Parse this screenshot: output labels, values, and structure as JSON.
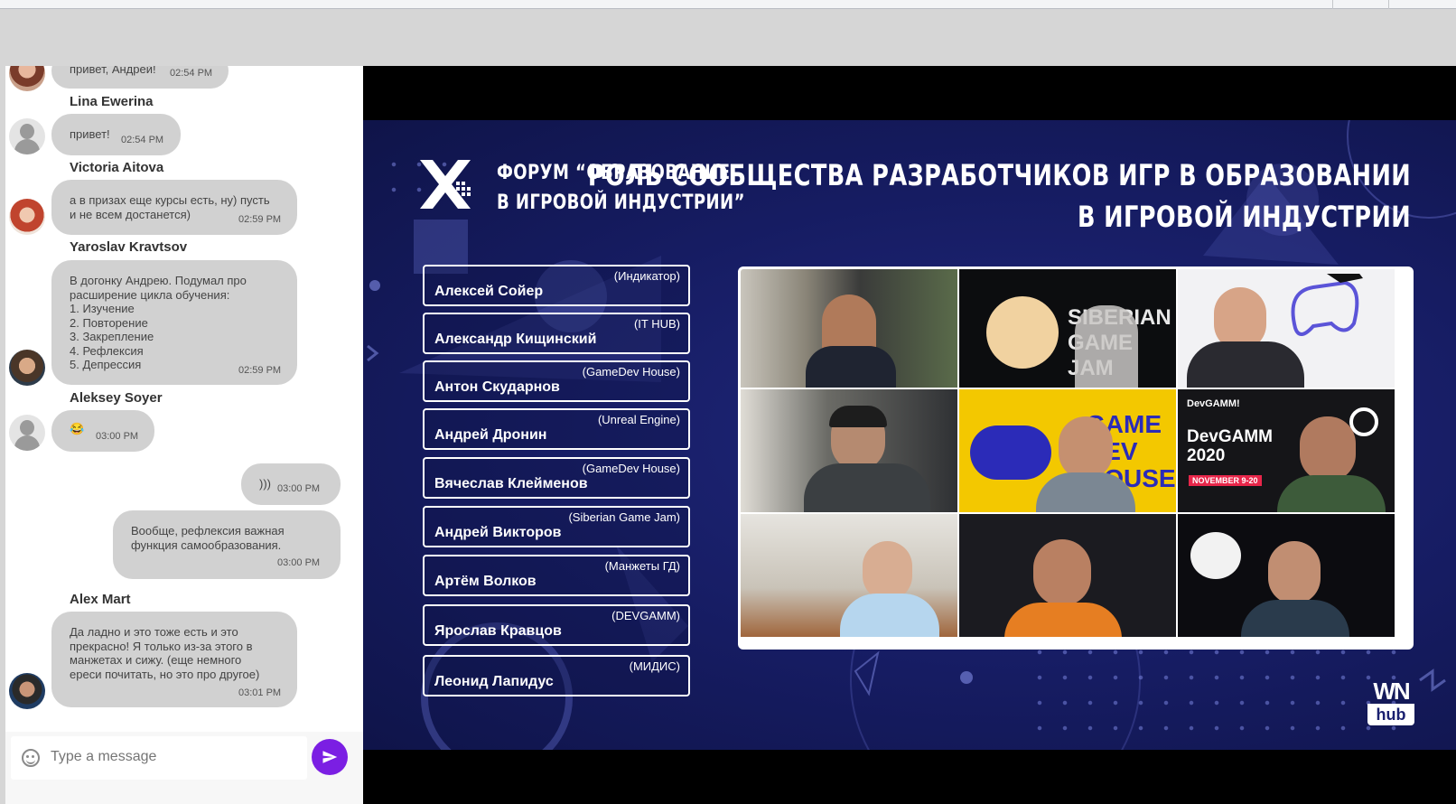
{
  "chat": {
    "messages": [
      {
        "sender": "",
        "text": "привет, Андрей!",
        "time": "02:54 PM"
      },
      {
        "sender": "Lina Ewerina",
        "text": "привет!",
        "time": "02:54 PM"
      },
      {
        "sender": "Victoria Aitova",
        "text": "а в призах еще курсы есть, ну) пусть\nи не всем достанется)",
        "time": "02:59 PM"
      },
      {
        "sender": "Yaroslav Kravtsov",
        "text": "В догонку Андрею. Подумал про\nрасширение цикла обучения:\n1. Изучение\n2. Повторение\n3. Закрепление\n4. Рефлексия\n5. Депрессия",
        "time": "02:59 PM"
      },
      {
        "sender": "Aleksey Soyer",
        "text": "😂",
        "time": "03:00 PM"
      },
      {
        "sender": "",
        "text": ")))",
        "time": "03:00 PM"
      },
      {
        "sender": "",
        "text": "Вообще, рефлексия важная\nфункция самообразования.",
        "time": "03:00 PM"
      },
      {
        "sender": "Alex Mart",
        "text": "Да ладно и это тоже есть и это\nпрекрасно! Я только из-за этого в\nманжетах и сижу. (еще немного\nереси почитать, но это про другое)",
        "time": "03:01 PM"
      }
    ],
    "composer": {
      "placeholder": "Type a message"
    }
  },
  "stage": {
    "forum_title_1": "ФОРУМ “ОБРАЗОВАНИЕ",
    "forum_title_2": "В ИГРОВОЙ ИНДУСТРИИ”",
    "main_title_1": "РОЛЬ СООБЩЕСТВА РАЗРАБОТЧИКОВ ИГР В ОБРАЗОВАНИИ",
    "main_title_2": "В ИГРОВОЙ ИНДУСТРИИ",
    "speakers": [
      {
        "name": "Алексей Сойер",
        "org": "(Индикатор)"
      },
      {
        "name": "Александр Кищинский",
        "org": "(IT HUB)"
      },
      {
        "name": "Антон Скударнов",
        "org": "(GameDev House)"
      },
      {
        "name": "Андрей Дронин",
        "org": "(Unreal Engine)"
      },
      {
        "name": "Вячеслав Клейменов",
        "org": "(GameDev House)"
      },
      {
        "name": "Андрей Викторов",
        "org": "(Siberian Game Jam)"
      },
      {
        "name": "Артём Волков",
        "org": "(Манжеты ГД)"
      },
      {
        "name": "Ярослав Кравцов",
        "org": "(DEVGAMM)"
      },
      {
        "name": "Леонид Лапидус",
        "org": "(МИДИС)"
      }
    ],
    "tiles": {
      "siberian": "SIBERIAN\nGAME JAM",
      "gamedev": "GAME\nDEV\nHOUSE",
      "devgamm_small": "DevGAMM!",
      "devgamm_big": "DevGAMM\n2020",
      "devgamm_date": "NOVEMBER 9-20"
    },
    "brand": {
      "wn": "WN",
      "hub": "hub"
    }
  },
  "colors": {
    "send": "#7b1fe3",
    "bubble": "#d1d1d1",
    "stage": "#161c62"
  }
}
